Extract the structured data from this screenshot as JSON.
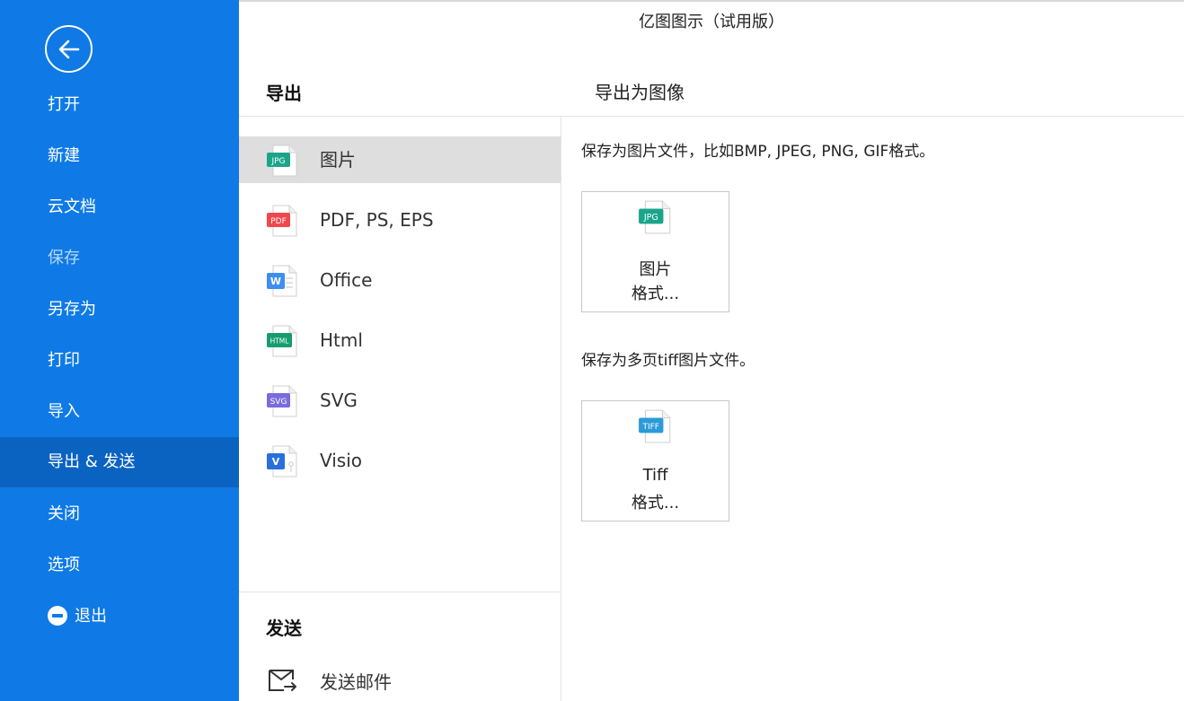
{
  "app_title": "亿图图示（试用版）",
  "sidebar": {
    "items": [
      {
        "label": "打开"
      },
      {
        "label": "新建"
      },
      {
        "label": "云文档"
      },
      {
        "label": "保存"
      },
      {
        "label": "另存为"
      },
      {
        "label": "打印"
      },
      {
        "label": "导入"
      },
      {
        "label": "导出 & 发送"
      },
      {
        "label": "关闭"
      },
      {
        "label": "选项"
      },
      {
        "label": "退出"
      }
    ],
    "active_item": "导出 & 发送"
  },
  "export_panel": {
    "heading": "导出",
    "formats": [
      {
        "label": "图片",
        "icon": "jpg-file-icon",
        "badge": "JPG",
        "color": "#1aa58a"
      },
      {
        "label": "PDF, PS, EPS",
        "icon": "pdf-file-icon",
        "badge": "PDF",
        "color": "#f0484d"
      },
      {
        "label": "Office",
        "icon": "word-file-icon",
        "badge": "W",
        "color": "#3d8ef0"
      },
      {
        "label": "Html",
        "icon": "html-file-icon",
        "badge": "HTML",
        "color": "#169c6f"
      },
      {
        "label": "SVG",
        "icon": "svg-file-icon",
        "badge": "SVG",
        "color": "#7a6bdc"
      },
      {
        "label": "Visio",
        "icon": "visio-file-icon",
        "badge": "V",
        "color": "#2a6fdb"
      }
    ],
    "selected": "图片"
  },
  "send_panel": {
    "heading": "发送",
    "items": [
      {
        "label": "发送邮件",
        "icon": "mail-send-icon"
      }
    ]
  },
  "right_panel": {
    "title": "导出为图像",
    "sections": [
      {
        "description": "保存为图片文件，比如BMP, JPEG, PNG, GIF格式。",
        "card": {
          "line1": "图片",
          "line2": "格式...",
          "icon": "jpg-file-icon",
          "badge": "JPG",
          "color": "#1aa58a"
        }
      },
      {
        "description": "保存为多页tiff图片文件。",
        "card": {
          "line1": "Tiff",
          "line2": "格式...",
          "icon": "tiff-file-icon",
          "badge": "TIFF",
          "color": "#2b9ad8"
        }
      }
    ]
  },
  "colors": {
    "sidebar_bg": "#0f7ae5",
    "sidebar_active": "#0b63c1",
    "selected_row": "#dedede"
  }
}
